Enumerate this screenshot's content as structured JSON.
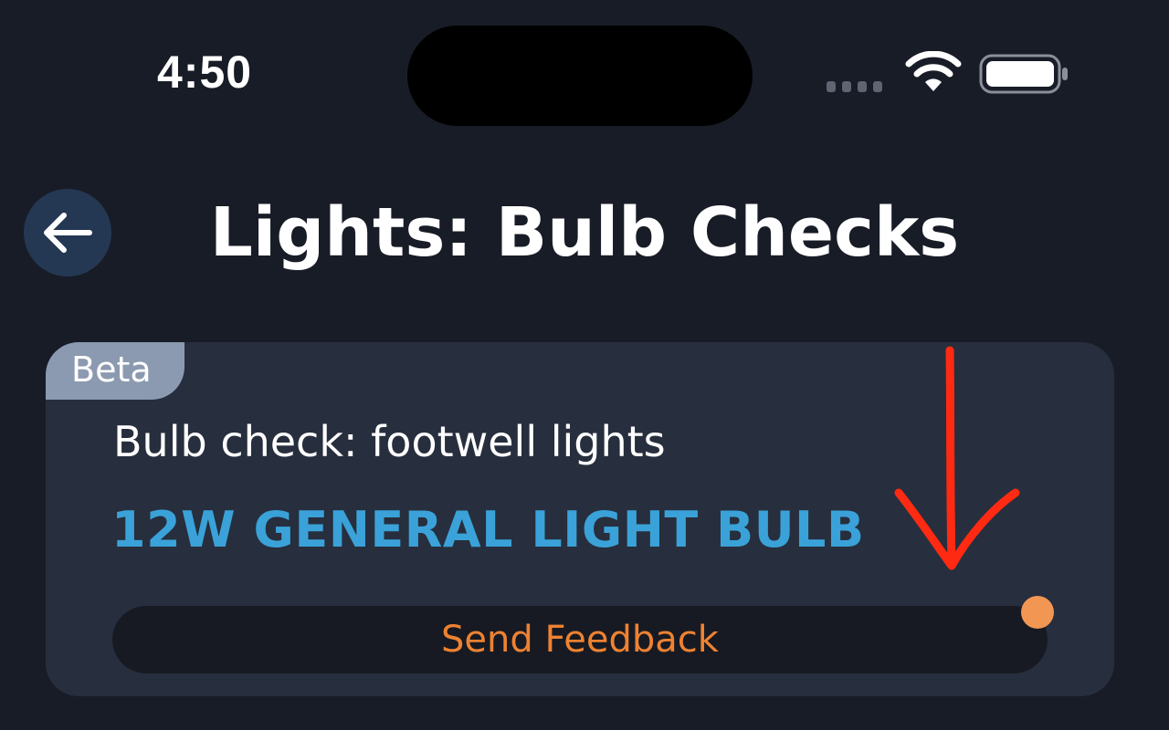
{
  "status_bar": {
    "time": "4:50",
    "wifi_icon": "wifi-icon",
    "battery_icon": "battery-icon",
    "signal_icon": "cellular-signal-icon"
  },
  "header": {
    "back_icon": "arrow-left-icon",
    "title": "Lights: Bulb Checks"
  },
  "card": {
    "badge": "Beta",
    "subtitle": "Bulb check: footwell lights",
    "headline": "12W GENERAL LIGHT BULB",
    "feedback_label": "Send Feedback"
  },
  "colors": {
    "background": "#181c26",
    "card": "#272e3d",
    "accent_blue": "#3aa2d8",
    "accent_orange": "#ee8232",
    "badge": "#8b9ab0",
    "annotation_red": "#ff2a12"
  }
}
